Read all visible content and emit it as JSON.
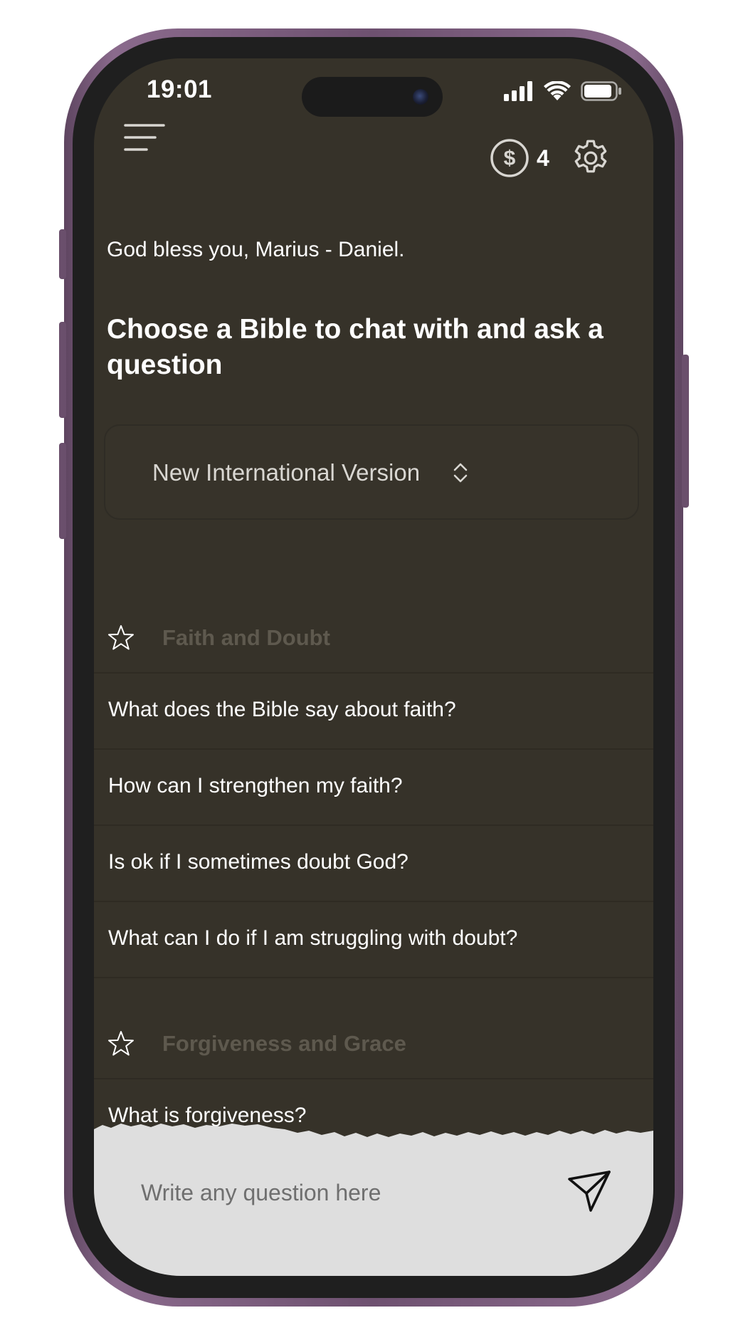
{
  "status_bar": {
    "time": "19:01"
  },
  "header": {
    "credits_count": "4",
    "icons": {
      "menu": "hamburger-menu-icon",
      "credits": "dollar-coin-icon",
      "settings": "gear-icon"
    }
  },
  "greeting": "God bless you, Marius - Daniel.",
  "headline": "Choose a Bible to chat with and ask a question",
  "bible_select": {
    "selected": "New International Version"
  },
  "sections": [
    {
      "title": "Faith and Doubt",
      "questions": [
        "What does the Bible say about faith?",
        "How can I strengthen my faith?",
        "Is ok if I sometimes doubt God?",
        "What can I do if I am struggling with doubt?"
      ]
    },
    {
      "title": "Forgiveness and Grace",
      "questions": [
        "What is forgiveness?"
      ]
    }
  ],
  "composer": {
    "placeholder": "Write any question here"
  },
  "colors": {
    "background": "#363229",
    "section_title": "#5e594e",
    "composer_background": "#dedede"
  }
}
